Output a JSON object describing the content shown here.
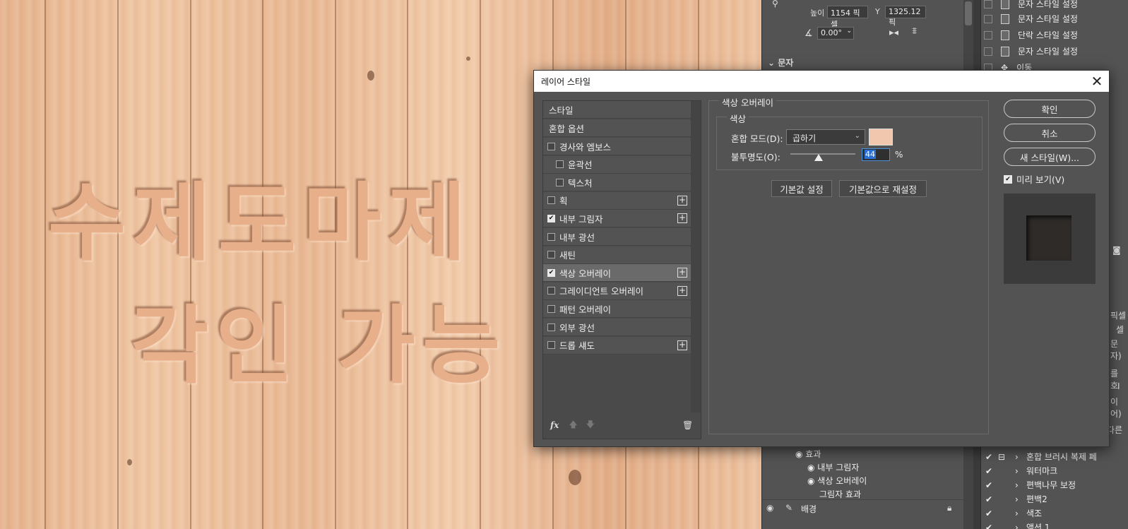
{
  "canvas": {
    "text_line1": "수제도마제",
    "text_line2": "각인 가능"
  },
  "properties": {
    "height_label": "높이",
    "height_value": "1154 픽셀",
    "y_label": "Y",
    "y_value": "1325.12 픽",
    "angle_value": "0.00°",
    "section_text": "문자"
  },
  "history": {
    "items": [
      {
        "label": "문자 스타일 설정"
      },
      {
        "label": "문자 스타일 설정"
      },
      {
        "label": "단락 스타일 설정"
      },
      {
        "label": "문자 스타일 설정"
      },
      {
        "label": "이동"
      }
    ],
    "right_fragments": [
      "픽셀",
      "셀",
      "문자)",
      "를 호",
      "I",
      "이어)",
      "다른"
    ]
  },
  "layers": {
    "effects_label": "효과",
    "effect_items": [
      "내부 그림자",
      "색상 오버레이"
    ],
    "shadow_effect": "그림자 효과",
    "background_label": "배경"
  },
  "actions": {
    "items": [
      "혼합 브러시 복제 페",
      "워터마크",
      "편백나무 보정",
      "편백2",
      "색조",
      "액션 1"
    ]
  },
  "dialog": {
    "title": "레이어 스타일",
    "styles_header": "스타일",
    "blend_options": "혼합 옵션",
    "items": [
      {
        "label": "경사와 엠보스",
        "checked": false,
        "plus": false,
        "indent": false
      },
      {
        "label": "윤곽선",
        "checked": false,
        "plus": false,
        "indent": true
      },
      {
        "label": "텍스처",
        "checked": false,
        "plus": false,
        "indent": true
      },
      {
        "label": "획",
        "checked": false,
        "plus": true,
        "indent": false
      },
      {
        "label": "내부 그림자",
        "checked": true,
        "plus": true,
        "indent": false
      },
      {
        "label": "내부 광선",
        "checked": false,
        "plus": false,
        "indent": false
      },
      {
        "label": "새틴",
        "checked": false,
        "plus": false,
        "indent": false
      },
      {
        "label": "색상 오버레이",
        "checked": true,
        "plus": true,
        "indent": false,
        "selected": true
      },
      {
        "label": "그레이디언트 오버레이",
        "checked": false,
        "plus": true,
        "indent": false
      },
      {
        "label": "패턴 오버레이",
        "checked": false,
        "plus": false,
        "indent": false
      },
      {
        "label": "외부 광선",
        "checked": false,
        "plus": false,
        "indent": false
      },
      {
        "label": "드롭 섀도",
        "checked": false,
        "plus": true,
        "indent": false
      }
    ],
    "section_title": "색상 오버레이",
    "color_group": "색상",
    "blend_mode_label": "혼합 모드(D):",
    "blend_mode_value": "곱하기",
    "overlay_color": "#f1c8ad",
    "opacity_label": "불투명도(O):",
    "opacity_value": "44",
    "opacity_fraction": 0.44,
    "percent": "%",
    "make_default": "기본값 설정",
    "reset_default": "기본값으로 재설정",
    "ok": "확인",
    "cancel": "취소",
    "new_style": "새 스타일(W)...",
    "preview_label": "미리 보기(V)",
    "preview_checked": true
  }
}
